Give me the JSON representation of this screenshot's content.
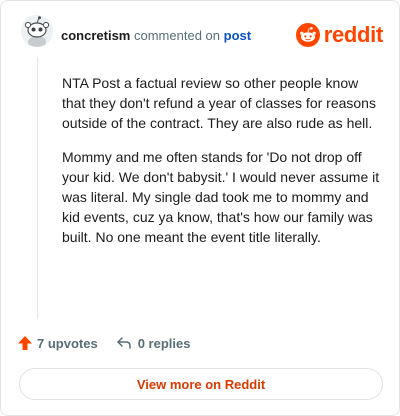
{
  "header": {
    "username": "concretism",
    "commented_text": "commented on",
    "post_link": "post",
    "brand": "reddit"
  },
  "comment": {
    "paragraphs": [
      "NTA Post a factual review so other people know that they don't refund a year of classes for reasons outside of the contract. They are also rude as hell.",
      "Mommy and me often stands for 'Do not drop off your kid. We don't babysit.' I would never assume it was literal. My single dad took me to mommy and kid events, cuz ya know, that's how our family was built. No one meant the event title literally."
    ]
  },
  "actions": {
    "upvotes": "7 upvotes",
    "replies": "0 replies"
  },
  "footer": {
    "view_more": "View more on Reddit"
  },
  "colors": {
    "brand": "#ff4500",
    "link": "#0a53c2",
    "view_more": "#d93a00",
    "muted": "#576f76"
  },
  "icons": {
    "avatar": "snoo-avatar-icon",
    "brand": "reddit-logo-icon",
    "upvote": "upvote-arrow-icon",
    "reply": "reply-arrow-icon"
  }
}
